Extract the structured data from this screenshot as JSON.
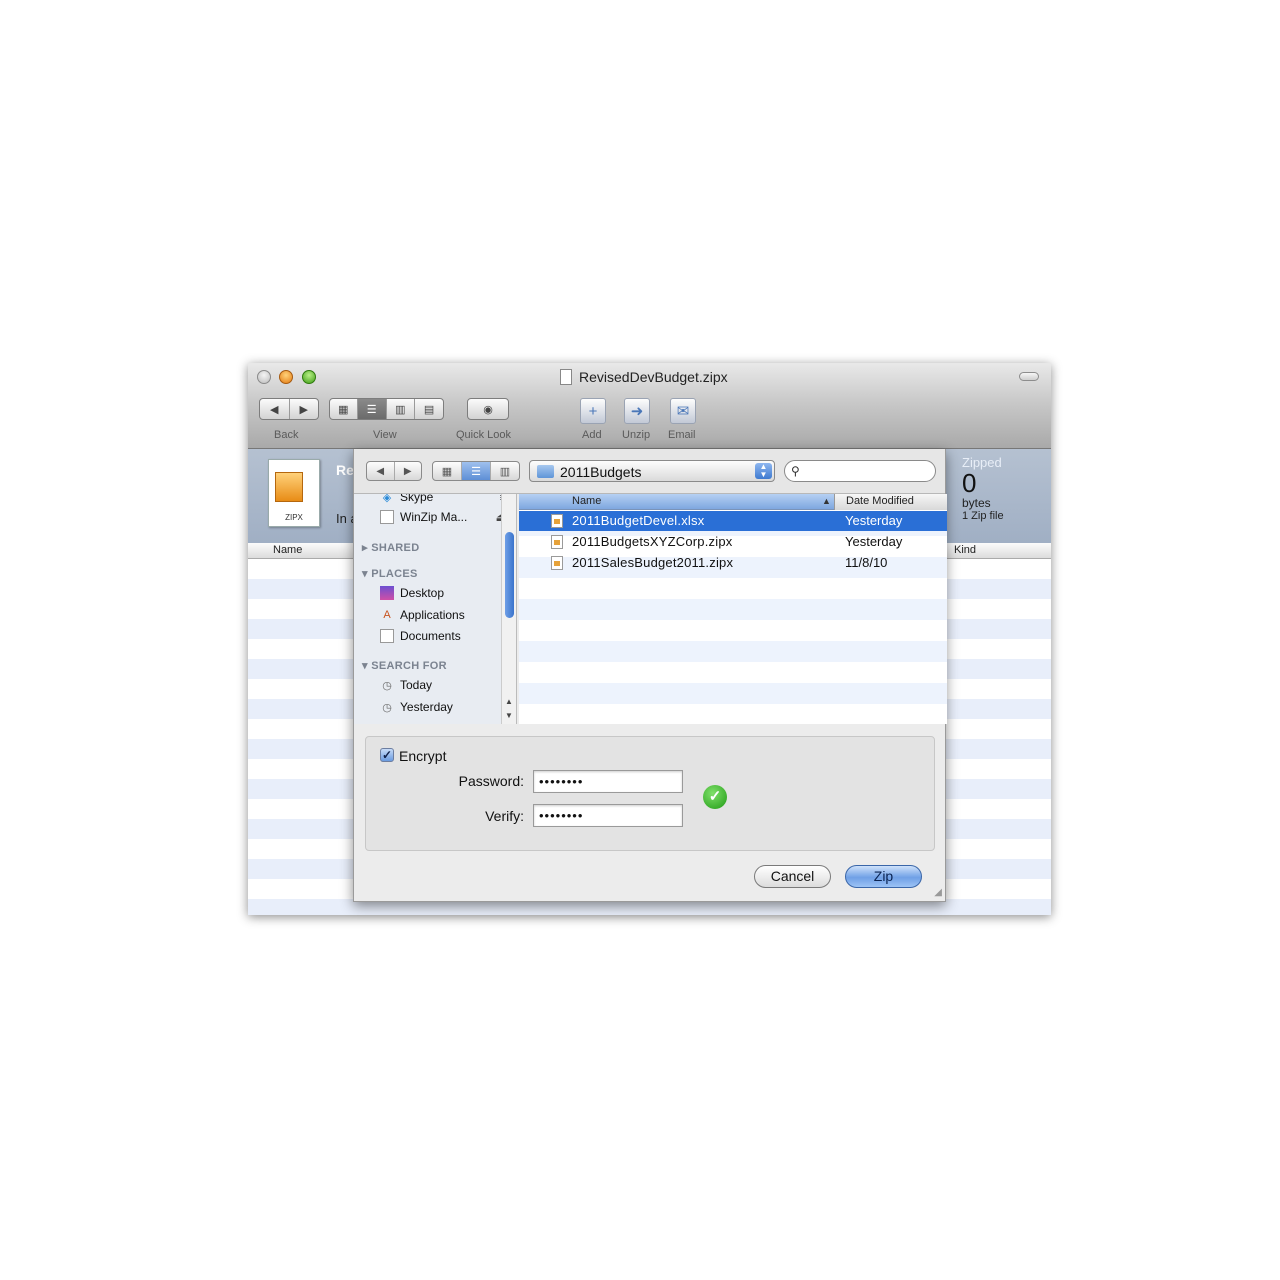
{
  "window": {
    "title": "RevisedDevBudget.zipx"
  },
  "toolbar": {
    "back_label": "Back",
    "view_label": "View",
    "quicklook_label": "Quick Look",
    "add_label": "Add",
    "unzip_label": "Unzip",
    "email_label": "Email"
  },
  "info": {
    "file_icon_text": "ZIPX",
    "partial_title": "Re",
    "partial_sub": "In a",
    "zipped_label": "Zipped",
    "zipped_value": "0",
    "zipped_unit": "bytes",
    "zip_count": "1 Zip file"
  },
  "list": {
    "name_header": "Name",
    "kind_header": "Kind"
  },
  "dialog": {
    "folder": "2011Budgets",
    "search_placeholder": "",
    "sidebar": {
      "devices": [
        {
          "label": "Skype",
          "icon": "skype-icon"
        },
        {
          "label": "WinZip Ma...",
          "icon": "disk-icon"
        }
      ],
      "shared_header": "SHARED",
      "places_header": "PLACES",
      "places": [
        {
          "label": "Desktop",
          "icon": "desktop-icon"
        },
        {
          "label": "Applications",
          "icon": "applications-icon"
        },
        {
          "label": "Documents",
          "icon": "documents-icon"
        }
      ],
      "search_header": "SEARCH FOR",
      "searches": [
        {
          "label": "Today",
          "icon": "clock-icon"
        },
        {
          "label": "Yesterday",
          "icon": "clock-icon"
        }
      ]
    },
    "columns": {
      "name": "Name",
      "date": "Date Modified"
    },
    "files": [
      {
        "name": "2011BudgetDevel.xlsx",
        "date": "Yesterday",
        "selected": true
      },
      {
        "name": "2011BudgetsXYZCorp.zipx",
        "date": "Yesterday",
        "selected": false
      },
      {
        "name": "2011SalesBudget2011.zipx",
        "date": "11/8/10",
        "selected": false
      }
    ],
    "encrypt": {
      "label": "Encrypt",
      "checked": true
    },
    "password": {
      "label": "Password:",
      "value": "••••••••"
    },
    "verify": {
      "label": "Verify:",
      "value": "••••••••"
    },
    "buttons": {
      "cancel": "Cancel",
      "zip": "Zip"
    }
  }
}
